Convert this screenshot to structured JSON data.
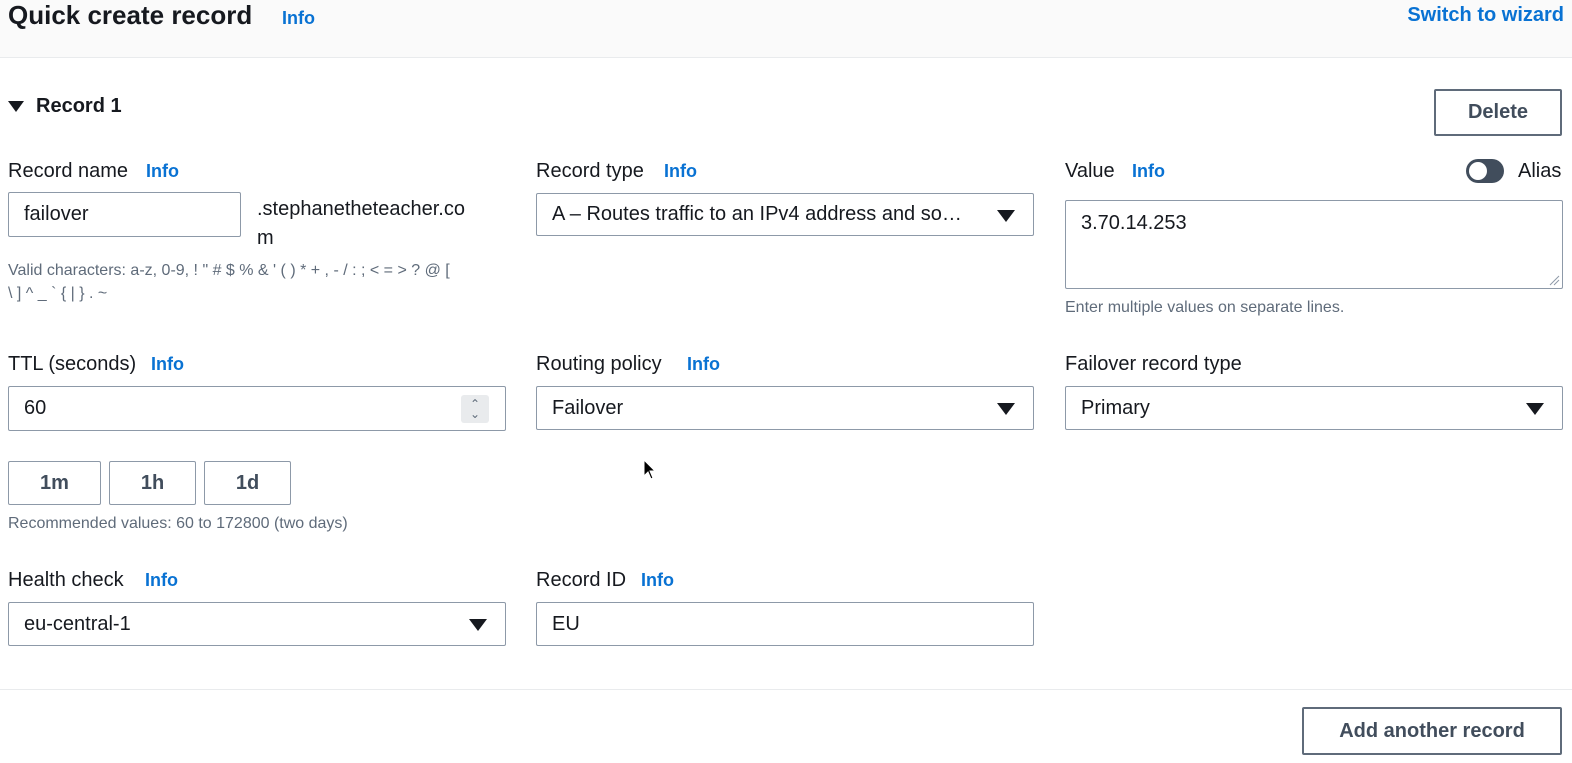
{
  "header": {
    "title": "Quick create record",
    "info": "Info",
    "switch_link": "Switch to wizard"
  },
  "record": {
    "section_title": "Record 1",
    "delete_label": "Delete",
    "record_name": {
      "label": "Record name",
      "info": "Info",
      "value": "failover",
      "domain_line1": ".stephanetheteacher.co",
      "domain_line2": "m",
      "hint_line1": "Valid characters: a-z, 0-9, ! \" # $ % & ' ( ) * + , - / : ; < = > ? @ [",
      "hint_line2": "\\ ] ^ _ ` { | } . ~"
    },
    "record_type": {
      "label": "Record type",
      "info": "Info",
      "value": "A – Routes traffic to an IPv4 address and so…"
    },
    "value_field": {
      "label": "Value",
      "info": "Info",
      "alias_label": "Alias",
      "alias_on": false,
      "value": "3.70.14.253",
      "hint": "Enter multiple values on separate lines."
    },
    "ttl": {
      "label": "TTL (seconds)",
      "info": "Info",
      "value": "60",
      "presets": [
        "1m",
        "1h",
        "1d"
      ],
      "hint": "Recommended values: 60 to 172800 (two days)"
    },
    "routing_policy": {
      "label": "Routing policy",
      "info": "Info",
      "value": "Failover"
    },
    "failover_type": {
      "label": "Failover record type",
      "value": "Primary"
    },
    "health_check": {
      "label": "Health check",
      "info": "Info",
      "value": "eu-central-1"
    },
    "record_id": {
      "label": "Record ID",
      "info": "Info",
      "value": "EU"
    }
  },
  "footer": {
    "add_label": "Add another record"
  },
  "colors": {
    "link": "#0972d3",
    "text": "#16191f",
    "muted": "#5f6b7a"
  }
}
